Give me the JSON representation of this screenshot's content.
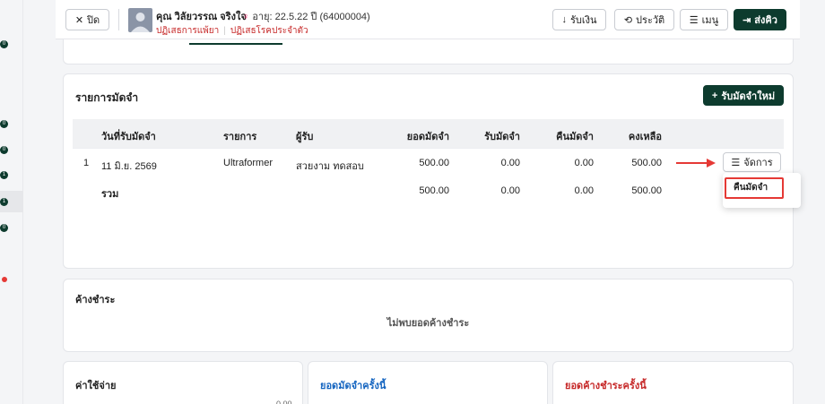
{
  "header": {
    "close_label": "ปิด",
    "patient_name": "คุณ วิลัยวรรณ จริงใจ",
    "age_text": "อายุ: 22.5.22 ปี (64000004)",
    "allergy_drug": "ปฏิเสธการแพ้ยา",
    "allergy_disease": "ปฏิเสธโรคประจำตัว",
    "receive_money_label": "รับเงิน",
    "history_label": "ประวัติ",
    "menu_label": "เมนู",
    "send_queue_label": "ส่งคิว"
  },
  "deposit": {
    "title": "รายการมัดจำ",
    "add_button_label": "รับมัดจำใหม่",
    "columns": [
      "วันที่รับมัดจำ",
      "รายการ",
      "ผู้รับ",
      "ยอดมัดจำ",
      "รับมัดจำ",
      "คืนมัดจำ",
      "คงเหลือ"
    ],
    "rows": [
      {
        "index": "1",
        "date": "11 มิ.ย. 2569",
        "item": "Ultraformer",
        "receiver": "สวยงาม ทดสอบ",
        "deposit_amount": "500.00",
        "received": "0.00",
        "refunded": "0.00",
        "balance": "500.00"
      }
    ],
    "total": {
      "label": "รวม",
      "deposit_amount": "500.00",
      "received": "0.00",
      "refunded": "0.00",
      "balance": "500.00"
    },
    "action_button_label": "จัดการ",
    "dropdown_item": "คืนมัดจำ"
  },
  "outstanding": {
    "title": "ค้างชำระ",
    "empty_text": "ไม่พบยอดค้างชำระ"
  },
  "summary": {
    "expenses_title": "ค่าใช้จ่าย",
    "deposit_this_time_title": "ยอดมัดจำครั้งนี้",
    "outstanding_this_time_title": "ยอดค้างชำระครั้งนี้"
  },
  "rail_badges": [
    "0",
    "0",
    "0",
    "1",
    "1",
    "0"
  ],
  "colors": {
    "primary": "#0d3b2e",
    "alert": "#e53935",
    "blue": "#1565c0"
  }
}
